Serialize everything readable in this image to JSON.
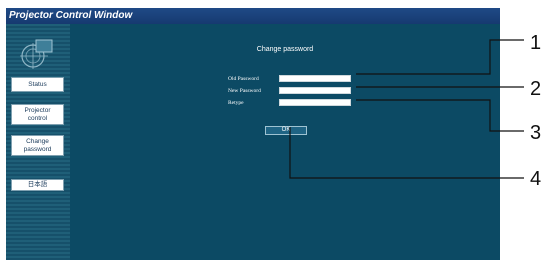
{
  "window": {
    "title": "Projector Control Window"
  },
  "sidebar": {
    "items": [
      {
        "label": "Status"
      },
      {
        "label": "Projector\ncontrol"
      },
      {
        "label": "Change\npassword"
      },
      {
        "label": "日本語"
      }
    ]
  },
  "main": {
    "heading": "Change password",
    "fields": [
      {
        "label": "Old Password",
        "value": ""
      },
      {
        "label": "New Password",
        "value": ""
      },
      {
        "label": "Retype",
        "value": ""
      }
    ],
    "ok_label": "OK"
  },
  "callouts": [
    "1",
    "2",
    "3",
    "4"
  ]
}
